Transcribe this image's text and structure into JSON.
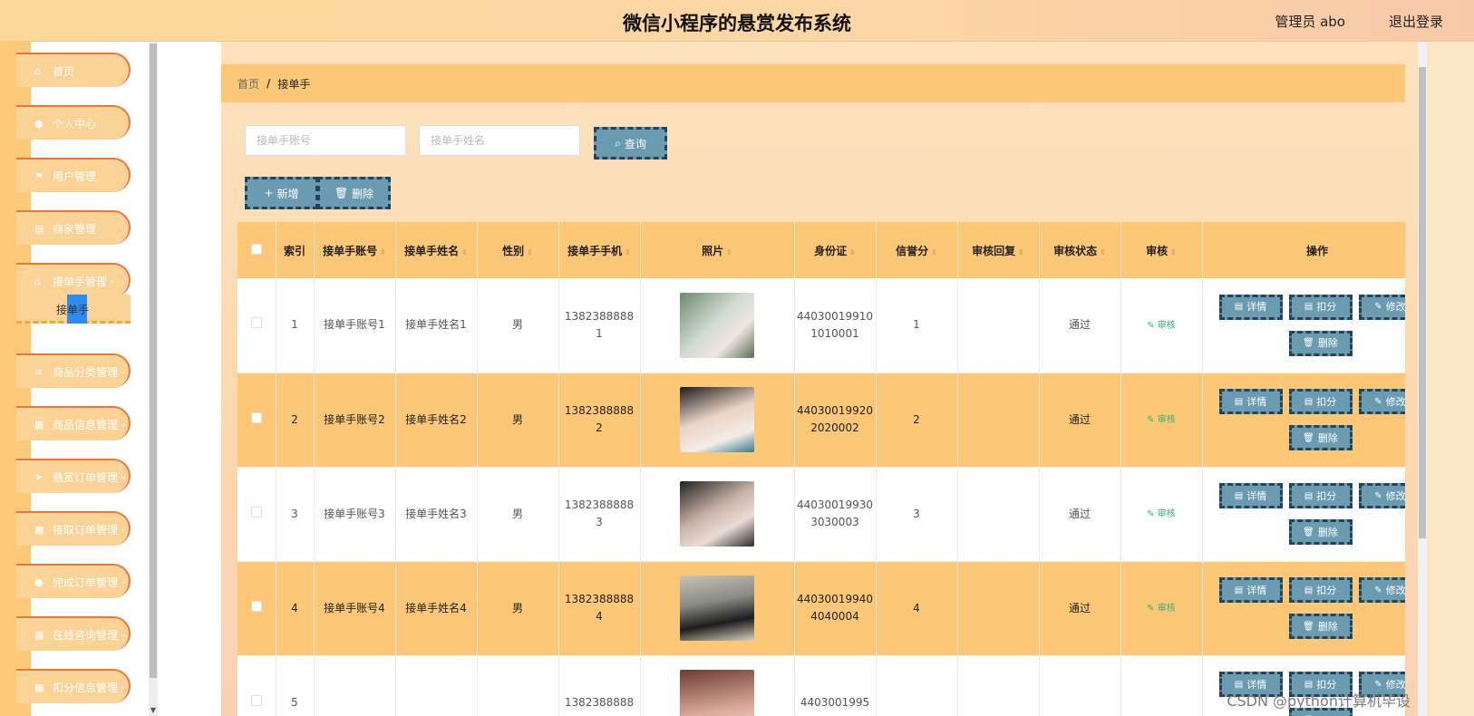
{
  "header": {
    "title": "微信小程序的悬赏发布系统",
    "user": "管理员 abo",
    "logout": "退出登录"
  },
  "sidebar": {
    "items": [
      {
        "label": "首页",
        "icon": "home-icon",
        "glyph": "⌂"
      },
      {
        "label": "个人中心",
        "icon": "user-icon",
        "glyph": "●"
      },
      {
        "label": "用户管理",
        "icon": "flag-icon",
        "glyph": "⚑"
      },
      {
        "label": "商家管理",
        "icon": "doc-icon",
        "glyph": "▤"
      },
      {
        "label": "接单手管理",
        "icon": "house-icon",
        "glyph": "⌂",
        "chevron": "⌄"
      },
      {
        "label": "商品分类管理",
        "icon": "list-icon",
        "glyph": "≡",
        "chevron": "⌄"
      },
      {
        "label": "商品信息管理",
        "icon": "grid-icon",
        "glyph": "▦",
        "chevron": "⌄"
      },
      {
        "label": "悬赏订单管理",
        "icon": "send-icon",
        "glyph": "➤",
        "chevron": "⌄"
      },
      {
        "label": "接取订单管理",
        "icon": "grid-icon",
        "glyph": "▦",
        "chevron": "⌄"
      },
      {
        "label": "完成订单管理",
        "icon": "user-icon",
        "glyph": "●",
        "chevron": "⌄"
      },
      {
        "label": "在线咨询管理",
        "icon": "grid-icon",
        "glyph": "▦",
        "chevron": "⌄"
      },
      {
        "label": "扣分信息管理",
        "icon": "grid-icon",
        "glyph": "▦",
        "chevron": "⌄"
      }
    ],
    "submenu_label": "接单手"
  },
  "breadcrumb": {
    "home": "首页",
    "separator": "/",
    "current": "接单手"
  },
  "search": {
    "account_placeholder": "接单手账号",
    "name_placeholder": "接单手姓名",
    "query_label": "查询"
  },
  "actions": {
    "add_label": "新增",
    "delete_label": "删除"
  },
  "table": {
    "columns": [
      "索引",
      "接单手账号",
      "接单手姓名",
      "性别",
      "接单手手机",
      "照片",
      "身份证",
      "信誉分",
      "审核回复",
      "审核状态",
      "审核",
      "操作"
    ],
    "rows": [
      {
        "index": "1",
        "account": "接单手账号1",
        "name": "接单手姓名1",
        "gender": "男",
        "phone": "13823888881",
        "id_card": "440300199101010001",
        "score": "1",
        "reply": "",
        "status": "通过",
        "review": "审核"
      },
      {
        "index": "2",
        "account": "接单手账号2",
        "name": "接单手姓名2",
        "gender": "男",
        "phone": "13823888882",
        "id_card": "440300199202020002",
        "score": "2",
        "reply": "",
        "status": "通过",
        "review": "审核"
      },
      {
        "index": "3",
        "account": "接单手账号3",
        "name": "接单手姓名3",
        "gender": "男",
        "phone": "13823888883",
        "id_card": "440300199303030003",
        "score": "3",
        "reply": "",
        "status": "通过",
        "review": "审核"
      },
      {
        "index": "4",
        "account": "接单手账号4",
        "name": "接单手姓名4",
        "gender": "男",
        "phone": "13823888884",
        "id_card": "440300199404040004",
        "score": "4",
        "reply": "",
        "status": "通过",
        "review": "审核"
      },
      {
        "index": "5",
        "account": "",
        "name": "",
        "gender": "",
        "phone": "1382388888",
        "id_card": "4403001995",
        "score": "",
        "reply": "",
        "status": "",
        "review": ""
      }
    ],
    "op_labels": {
      "detail": "详情",
      "deduct": "扣分",
      "edit": "修改",
      "delete": "删除"
    }
  },
  "watermark": "CSDN @python计算机毕设",
  "colors": {
    "accent": "#fcc777",
    "button": "#6a9bb1",
    "button_border": "#22435a",
    "menu_border": "#e9773b",
    "review_green": "#2bb673"
  }
}
